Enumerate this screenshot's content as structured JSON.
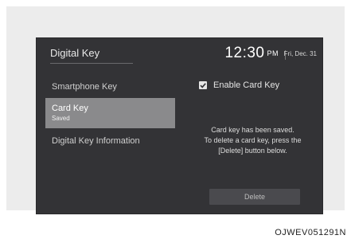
{
  "header": {
    "title": "Digital Key",
    "time": "12:30",
    "ampm": "PM",
    "date": "Fri, Dec. 31"
  },
  "menu": {
    "items": [
      {
        "label": "Smartphone Key"
      },
      {
        "label": "Card Key",
        "sublabel": "Saved",
        "selected": true
      },
      {
        "label": "Digital Key Information"
      }
    ]
  },
  "content": {
    "enable_card_key_label": "Enable Card Key",
    "enable_card_key_checked": true,
    "message_lines": [
      "Card key has been saved.",
      "To delete a card key, press the",
      "[Delete] button below."
    ],
    "delete_label": "Delete"
  },
  "caption": "OJWEV051291N",
  "colors": {
    "screen_bg": "#333336",
    "selected_item_bg": "#8a8a8c",
    "button_bg": "#4a4a4e"
  }
}
